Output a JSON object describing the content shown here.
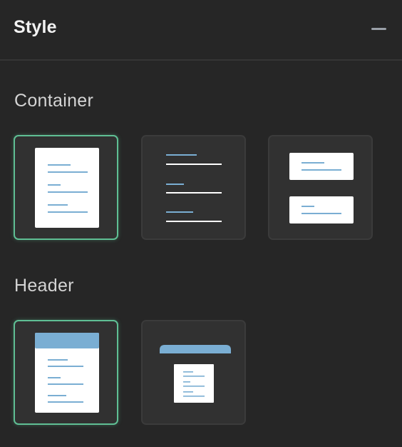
{
  "panel": {
    "title": "Style",
    "collapse_icon": "minus-icon"
  },
  "sections": {
    "container": {
      "label": "Container",
      "options": [
        {
          "id": "container-card",
          "icon": "document-card-icon",
          "selected": true
        },
        {
          "id": "container-plain",
          "icon": "plain-lines-icon",
          "selected": false
        },
        {
          "id": "container-split",
          "icon": "split-cards-icon",
          "selected": false
        }
      ]
    },
    "header": {
      "label": "Header",
      "options": [
        {
          "id": "header-attached",
          "icon": "attached-header-icon",
          "selected": true
        },
        {
          "id": "header-detached",
          "icon": "detached-header-icon",
          "selected": false
        }
      ]
    }
  },
  "colors": {
    "background": "#262626",
    "tile": "#313131",
    "selected_border": "#5fbf94",
    "accent_blue": "#7aaed3"
  }
}
